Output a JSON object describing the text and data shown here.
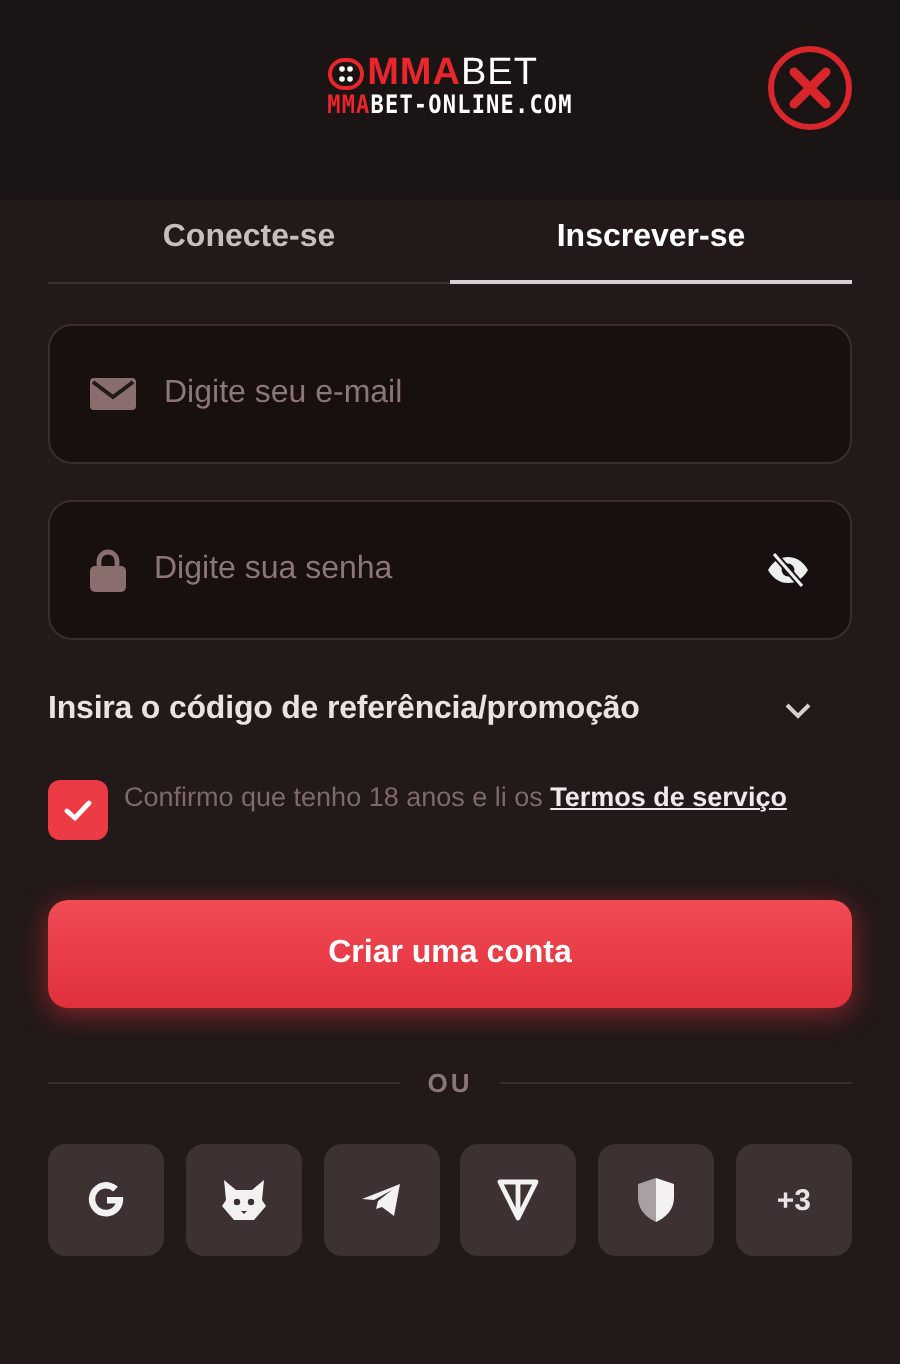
{
  "header": {
    "logo": {
      "accent": "MMA",
      "rest": "BET"
    },
    "site": {
      "accent": "MMA",
      "rest": "BET-ONLINE.COM"
    }
  },
  "tabs": [
    {
      "label": "Conecte-se",
      "selected": false
    },
    {
      "label": "Inscrever-se",
      "selected": true
    }
  ],
  "fields": [
    {
      "kind": "email",
      "placeholder": "Digite seu e-mail"
    },
    {
      "kind": "password",
      "placeholder": "Digite sua senha"
    }
  ],
  "referral": {
    "label": "Insira o código de referência/promoção",
    "expanded": false
  },
  "terms": {
    "checked": true,
    "text": "Confirmo que tenho 18 anos e li os ",
    "link": "Termos de serviço"
  },
  "submit": "Criar uma conta",
  "divider": "OU",
  "social": [
    {
      "kind": "google"
    },
    {
      "kind": "fox"
    },
    {
      "kind": "telegram"
    },
    {
      "kind": "ton"
    },
    {
      "kind": "shield"
    },
    {
      "kind": "more",
      "label": "+3"
    }
  ]
}
